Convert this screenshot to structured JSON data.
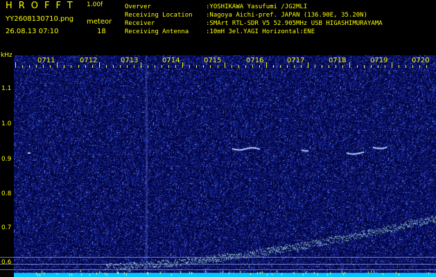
{
  "header": {
    "app_name": "HROFFT",
    "version": "1.00f",
    "filename": "YY2608130710.png",
    "meteor_label": "meteor",
    "datetime": "26.08.13 07:10",
    "meteor_count": "18"
  },
  "info": [
    {
      "key": "Overver",
      "value": ":YOSHIKAWA Yasufumi /JG2MLI"
    },
    {
      "key": "Receiving Location",
      "value": ":Nagoya Aichi-pref. JAPAN (136.90E, 35.20N)"
    },
    {
      "key": "Receiver",
      "value": ":SMArt RTL-SDR V5 52.905MHz USB HIGASHIMURAYAMA"
    },
    {
      "key": "Receiving Antenna",
      "value": ":10mH 3el.YAGI Horizontal:ENE"
    }
  ],
  "axis": {
    "unit": "kHz",
    "y_ticks": [
      "1.1",
      "1.0",
      "0.9",
      "0.8",
      "0.7",
      "0.6"
    ],
    "x_ticks": [
      "0711",
      "0712",
      "0713",
      "0714",
      "0715",
      "0716",
      "0717",
      "0718",
      "0719",
      "0720"
    ]
  },
  "colors": {
    "background": "#000000",
    "text": "#ffff00",
    "noise_dark": "#0a0a6a",
    "noise_mid": "#2540c8",
    "noise_light": "#7090ff",
    "trace": "#c0ffe0",
    "baseline": "#00ffff"
  }
}
